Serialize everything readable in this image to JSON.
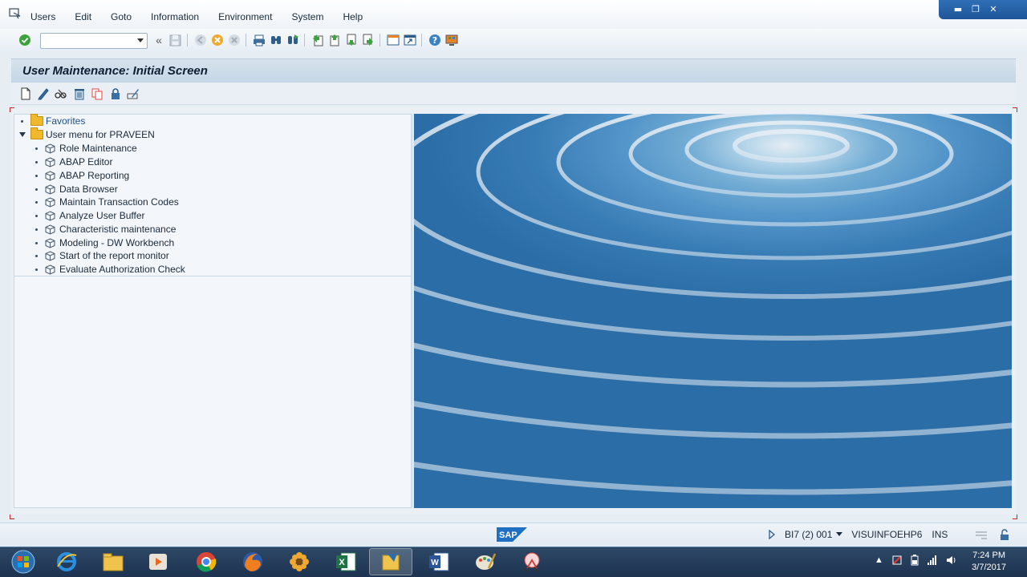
{
  "menubar": {
    "items": [
      "Users",
      "Edit",
      "Goto",
      "Information",
      "Environment",
      "System",
      "Help"
    ],
    "window_controls": [
      "minimize",
      "restore",
      "close"
    ]
  },
  "toolbar": {
    "command_field_value": "",
    "icons": [
      "enter-icon",
      "command-dropdown-icon",
      "back-double-icon",
      "save-icon",
      "back-icon",
      "exit-icon",
      "cancel-icon",
      "print-icon",
      "find-icon",
      "find-next-icon",
      "first-page-icon",
      "previous-page-icon",
      "next-page-icon",
      "last-page-icon",
      "create-session-icon",
      "shortcut-icon",
      "help-icon",
      "customize-layout-icon"
    ]
  },
  "title": "User Maintenance: Initial Screen",
  "app_toolbar": {
    "icons": [
      "create-icon",
      "change-icon",
      "display-icon",
      "delete-icon",
      "copy-icon",
      "lock-icon",
      "change-password-icon"
    ]
  },
  "tree": {
    "favorites": "Favorites",
    "user_menu": "User menu for PRAVEEN",
    "items": [
      "Role Maintenance",
      "ABAP Editor",
      "ABAP Reporting",
      "Data Browser",
      "Maintain Transaction Codes",
      "Analyze User Buffer",
      "Characteristic maintenance",
      "Modeling - DW Workbench",
      "Start of the report monitor",
      "Evaluate Authorization Check"
    ]
  },
  "status": {
    "logo": "SAP",
    "system": "BI7 (2) 001",
    "server": "VISUINFOEHP6",
    "mode": "INS"
  },
  "taskbar": {
    "apps": [
      "start-button",
      "internet-explorer",
      "file-explorer",
      "media-player",
      "chrome",
      "firefox",
      "app-flower",
      "excel",
      "sap-logon",
      "word",
      "paint",
      "snipping-tool"
    ],
    "time": "7:24 PM",
    "date": "3/7/2017"
  },
  "colors": {
    "title_bar": "#c5d6e5",
    "accent_blue": "#2f6fb6",
    "taskbar": "#1d3350",
    "folder": "#f0b82c"
  }
}
